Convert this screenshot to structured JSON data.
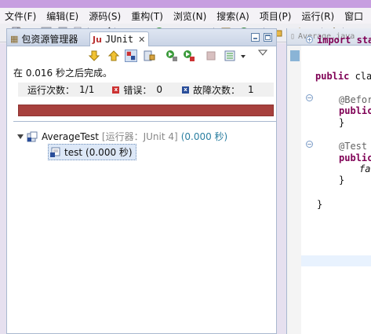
{
  "menu": [
    "文件(F)",
    "编辑(E)",
    "源码(S)",
    "重构(T)",
    "浏览(N)",
    "搜索(A)",
    "项目(P)",
    "运行(R)",
    "窗口"
  ],
  "toolbar_icons": [
    "new-icon",
    "save-icon",
    "save-all-icon",
    "print-icon",
    "skip-breakpoints-icon",
    "debug-icon",
    "run-icon",
    "external-tools-icon",
    "new-package-icon",
    "new-class-icon",
    "open-folder-icon",
    "pencil-icon",
    "pin-icon",
    "brush-icon"
  ],
  "tabs": {
    "package_explorer": "包资源管理器",
    "junit": "JUnit"
  },
  "junit": {
    "status": "在 0.016 秒之后完成。",
    "runs_label": "运行次数：",
    "runs_value": "1/1",
    "errors_label": "错误：",
    "errors_value": "0",
    "failures_label": "故障次数：",
    "failures_value": "1",
    "progress_color": "#a7403d",
    "progress_fraction": 1.0,
    "tree": {
      "suite_name": "AverageTest",
      "suite_runner": "[运行器：JUnit 4]",
      "suite_time": "(0.000 秒)",
      "test_name": "test",
      "test_time": "(0.000 秒)"
    }
  },
  "editor": {
    "tab_label": "Average.java",
    "lines": [
      "import sta",
      "public cla",
      "@Befor",
      "public",
      "}",
      "@Test",
      "public",
      "fa",
      "}",
      "}"
    ]
  }
}
